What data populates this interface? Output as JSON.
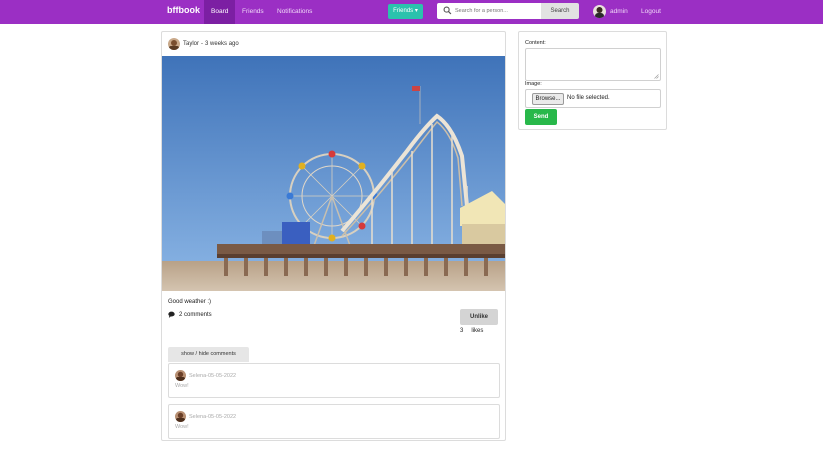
{
  "navbar": {
    "brand": "bffbook",
    "links": [
      "Board",
      "Friends",
      "Notifications"
    ],
    "friends_dropdown": "Friends ▾",
    "search_placeholder": "Search for a person...",
    "search_button": "Search",
    "user_name": "admin",
    "logout": "Logout"
  },
  "post": {
    "author": "Taylor",
    "separator": "-",
    "time": "3 weeks ago",
    "text": "Good weather :)",
    "comments_count": "2 comments",
    "unlike_button": "Unlike",
    "likes_count": "3",
    "likes_label": "likes",
    "toggle_comments": "show / hide comments",
    "comments": [
      {
        "meta": "Selena-05-05-2022",
        "body": "Wow!"
      },
      {
        "meta": "Selena-05-05-2022",
        "body": "Wow!"
      }
    ]
  },
  "compose": {
    "content_label": "Content:",
    "image_label": "Image:",
    "browse_button": "Browse...",
    "file_status": "No file selected.",
    "send_button": "Send"
  },
  "colors": {
    "navbar": "#9b2fc4",
    "friends_button": "#2bc2ad",
    "send_button": "#28b84a"
  },
  "icons": [
    "search-icon",
    "comment-icon",
    "resize-grip-icon"
  ]
}
